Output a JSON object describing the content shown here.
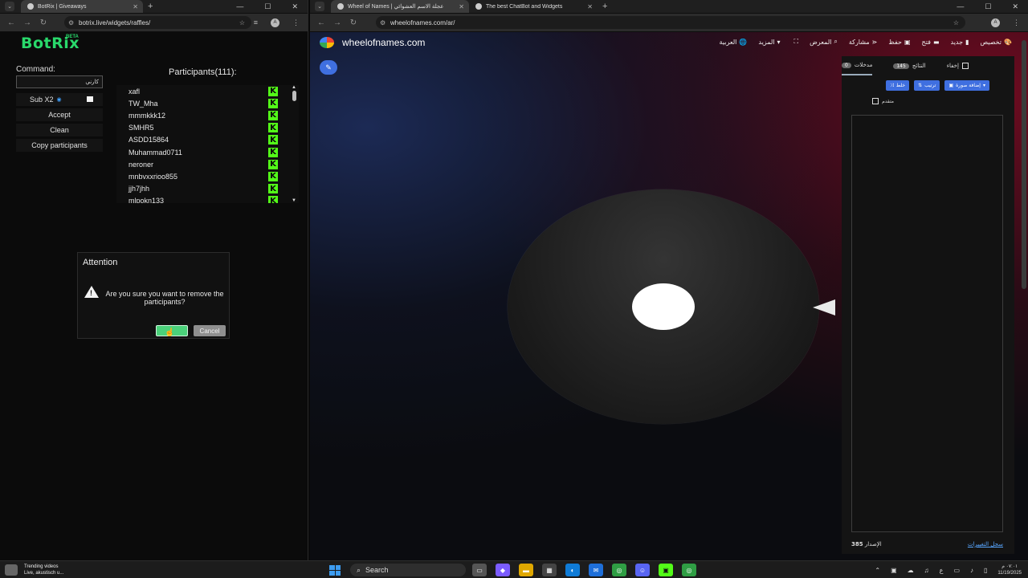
{
  "left_browser": {
    "tab": {
      "title": "BotRix | Giveaways"
    },
    "url": "botrix.live/widgets/raffles/",
    "avatar_letter": "A"
  },
  "right_browser": {
    "tabs": [
      {
        "title": "Wheel of Names | عجلة الاسم العشوائي"
      },
      {
        "title": "The best ChatBot and Widgets"
      }
    ],
    "url": "wheelofnames.com/ar/",
    "avatar_letter": "A"
  },
  "botrix": {
    "logo": "BotRix",
    "beta": "BETA",
    "command_label": "Command:",
    "command_value": "كارني",
    "sub_label": "Sub X2",
    "accept_label": "Accept",
    "clean_label": "Clean",
    "copy_label": "Copy participants",
    "participants_title": "Participants(111):",
    "participants": [
      {
        "name": "xafl"
      },
      {
        "name": "TW_Mha"
      },
      {
        "name": "mmmkkk12"
      },
      {
        "name": "SMHR5"
      },
      {
        "name": "ASDD15864"
      },
      {
        "name": "Muhammad0711"
      },
      {
        "name": "neroner"
      },
      {
        "name": "mnbvxxrioo855"
      },
      {
        "name": "jjh7jhh"
      },
      {
        "name": "mlpokn133"
      }
    ],
    "kick_glyph": "K",
    "dialog": {
      "title": "Attention",
      "message": "Are you sure you want to remove the participants?",
      "cancel": "Cancel"
    }
  },
  "wheel": {
    "site_name": "wheelofnames.com",
    "menu": [
      {
        "label": "تخصيص",
        "icon": "palette-icon",
        "glyph": "🎨"
      },
      {
        "label": "جديد",
        "icon": "file-icon",
        "glyph": "▮"
      },
      {
        "label": "فتح",
        "icon": "folder-icon",
        "glyph": "▬"
      },
      {
        "label": "حفظ",
        "icon": "save-icon",
        "glyph": "▣"
      },
      {
        "label": "مشاركة",
        "icon": "share-icon",
        "glyph": "⋖"
      },
      {
        "label": "المعرض",
        "icon": "search-icon",
        "glyph": "⌕"
      },
      {
        "label": "",
        "icon": "fullscreen-icon",
        "glyph": "⛶"
      },
      {
        "label": "المزيد",
        "icon": "caret-down-icon",
        "glyph": "▾"
      },
      {
        "label": "العربية",
        "icon": "globe-icon",
        "glyph": "🌐"
      }
    ],
    "panel": {
      "hide_label": "إخفاء",
      "results_label": "النتائج",
      "results_count": "145",
      "entries_label": "مدخلات",
      "entries_count": "0",
      "shuffle_label": "خلط",
      "sort_label": "ترتيب",
      "add_image_label": "إضافة صورة",
      "advanced_label": "متقدم",
      "version_label": "الإصدار",
      "version": "385",
      "changelog_label": "سجل التغييرات"
    }
  },
  "taskbar": {
    "news_title": "Trending videos",
    "news_sub": "Live, akustisch u...",
    "search": "Search",
    "lang": "ع",
    "time": "٠٧:٠١ م",
    "date": "11/19/2025"
  }
}
